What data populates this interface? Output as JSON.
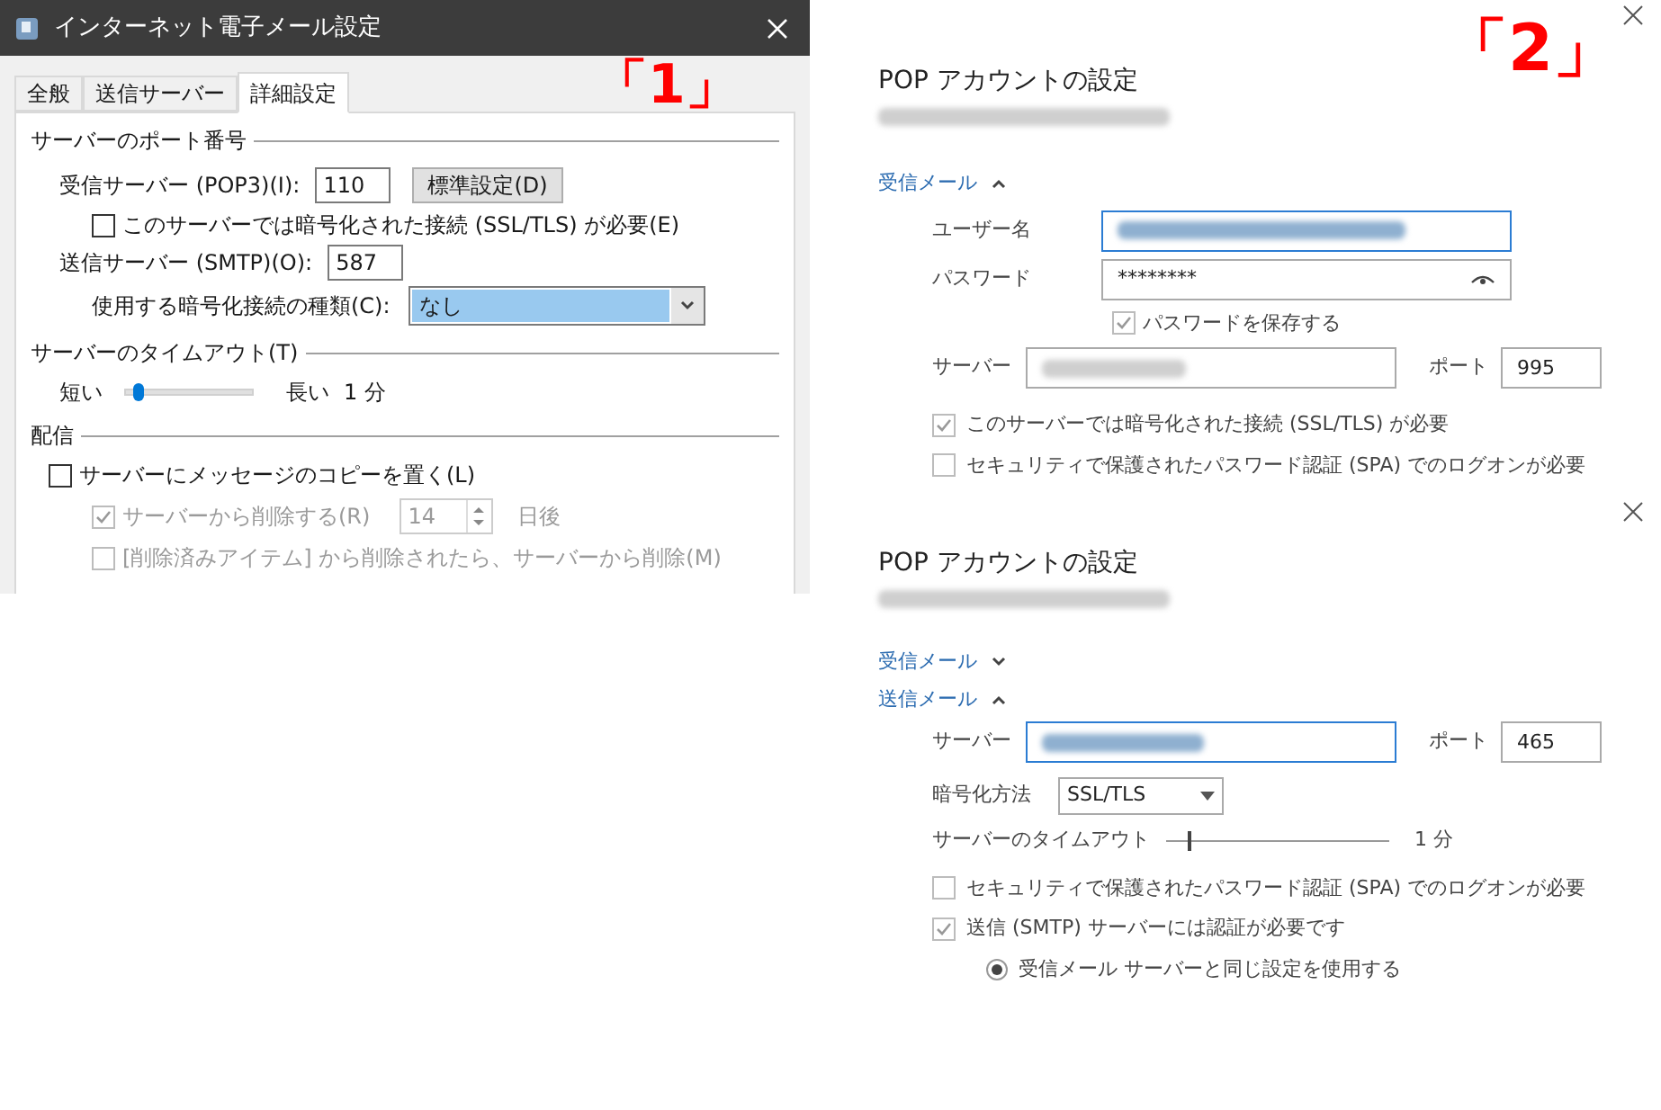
{
  "dialog": {
    "title": "インターネット電子メール設定",
    "marker": "「1」",
    "tabs": [
      {
        "label": "全般",
        "selected": false
      },
      {
        "label": "送信サーバー",
        "selected": false
      },
      {
        "label": "詳細設定",
        "selected": true
      }
    ],
    "ports": {
      "heading": "サーバーのポート番号",
      "incoming_label": "受信サーバー (POP3)(I):",
      "incoming_value": "110",
      "default_button": "標準設定(D)",
      "ssl": {
        "label": "このサーバーでは暗号化された接続 (SSL/TLS) が必要(E)",
        "checked": false
      },
      "outgoing_label": "送信サーバー (SMTP)(O):",
      "outgoing_value": "587",
      "encryption_label": "使用する暗号化接続の種類(C):",
      "encryption_value": "なし"
    },
    "timeout": {
      "heading": "サーバーのタイムアウト(T)",
      "short": "短い",
      "long": "長い",
      "value": "1 分",
      "level": 0.1
    },
    "delivery": {
      "heading": "配信",
      "days_value": "14",
      "days_unit": "日後",
      "options": [
        {
          "label": "サーバーにメッセージのコピーを置く(L)",
          "checked": false,
          "disabled": false
        },
        {
          "label": "サーバーから削除する(R)",
          "checked": true,
          "disabled": true
        },
        {
          "label": "[削除済みアイテム] から削除されたら、サーバーから削除(M)",
          "checked": false,
          "disabled": true
        }
      ]
    }
  },
  "panel_1": {
    "marker": "「2」",
    "title": "POP アカウントの設定",
    "incoming": {
      "label": "受信メール",
      "expanded": true
    },
    "username_label": "ユーザー名",
    "password_label": "パスワード",
    "password_value": "********",
    "save_password": {
      "label": "パスワードを保存する",
      "checked": true
    },
    "server_label": "サーバー",
    "port_label": "ポート",
    "port_value": "995",
    "checks": [
      {
        "label": "このサーバーでは暗号化された接続 (SSL/TLS) が必要",
        "checked": true
      },
      {
        "label": "セキュリティで保護されたパスワード認証 (SPA) でのログオンが必要",
        "checked": false
      }
    ]
  },
  "panel_2": {
    "title": "POP アカウントの設定",
    "incoming": {
      "label": "受信メール",
      "expanded": false
    },
    "outgoing": {
      "label": "送信メール",
      "expanded": true
    },
    "server_label": "サーバー",
    "port_label": "ポート",
    "port_value": "465",
    "encryption_label": "暗号化方法",
    "encryption_value": "SSL/TLS",
    "timeout": {
      "label": "サーバーのタイムアウト",
      "level": 0.1,
      "value": "1 分"
    },
    "checks": [
      {
        "label": "セキュリティで保護されたパスワード認証 (SPA) でのログオンが必要",
        "checked": false
      },
      {
        "label": "送信 (SMTP) サーバーには認証が必要です",
        "checked": true
      }
    ],
    "radios": [
      {
        "label": "受信メール サーバーと同じ設定を使用する",
        "selected": true
      }
    ]
  }
}
